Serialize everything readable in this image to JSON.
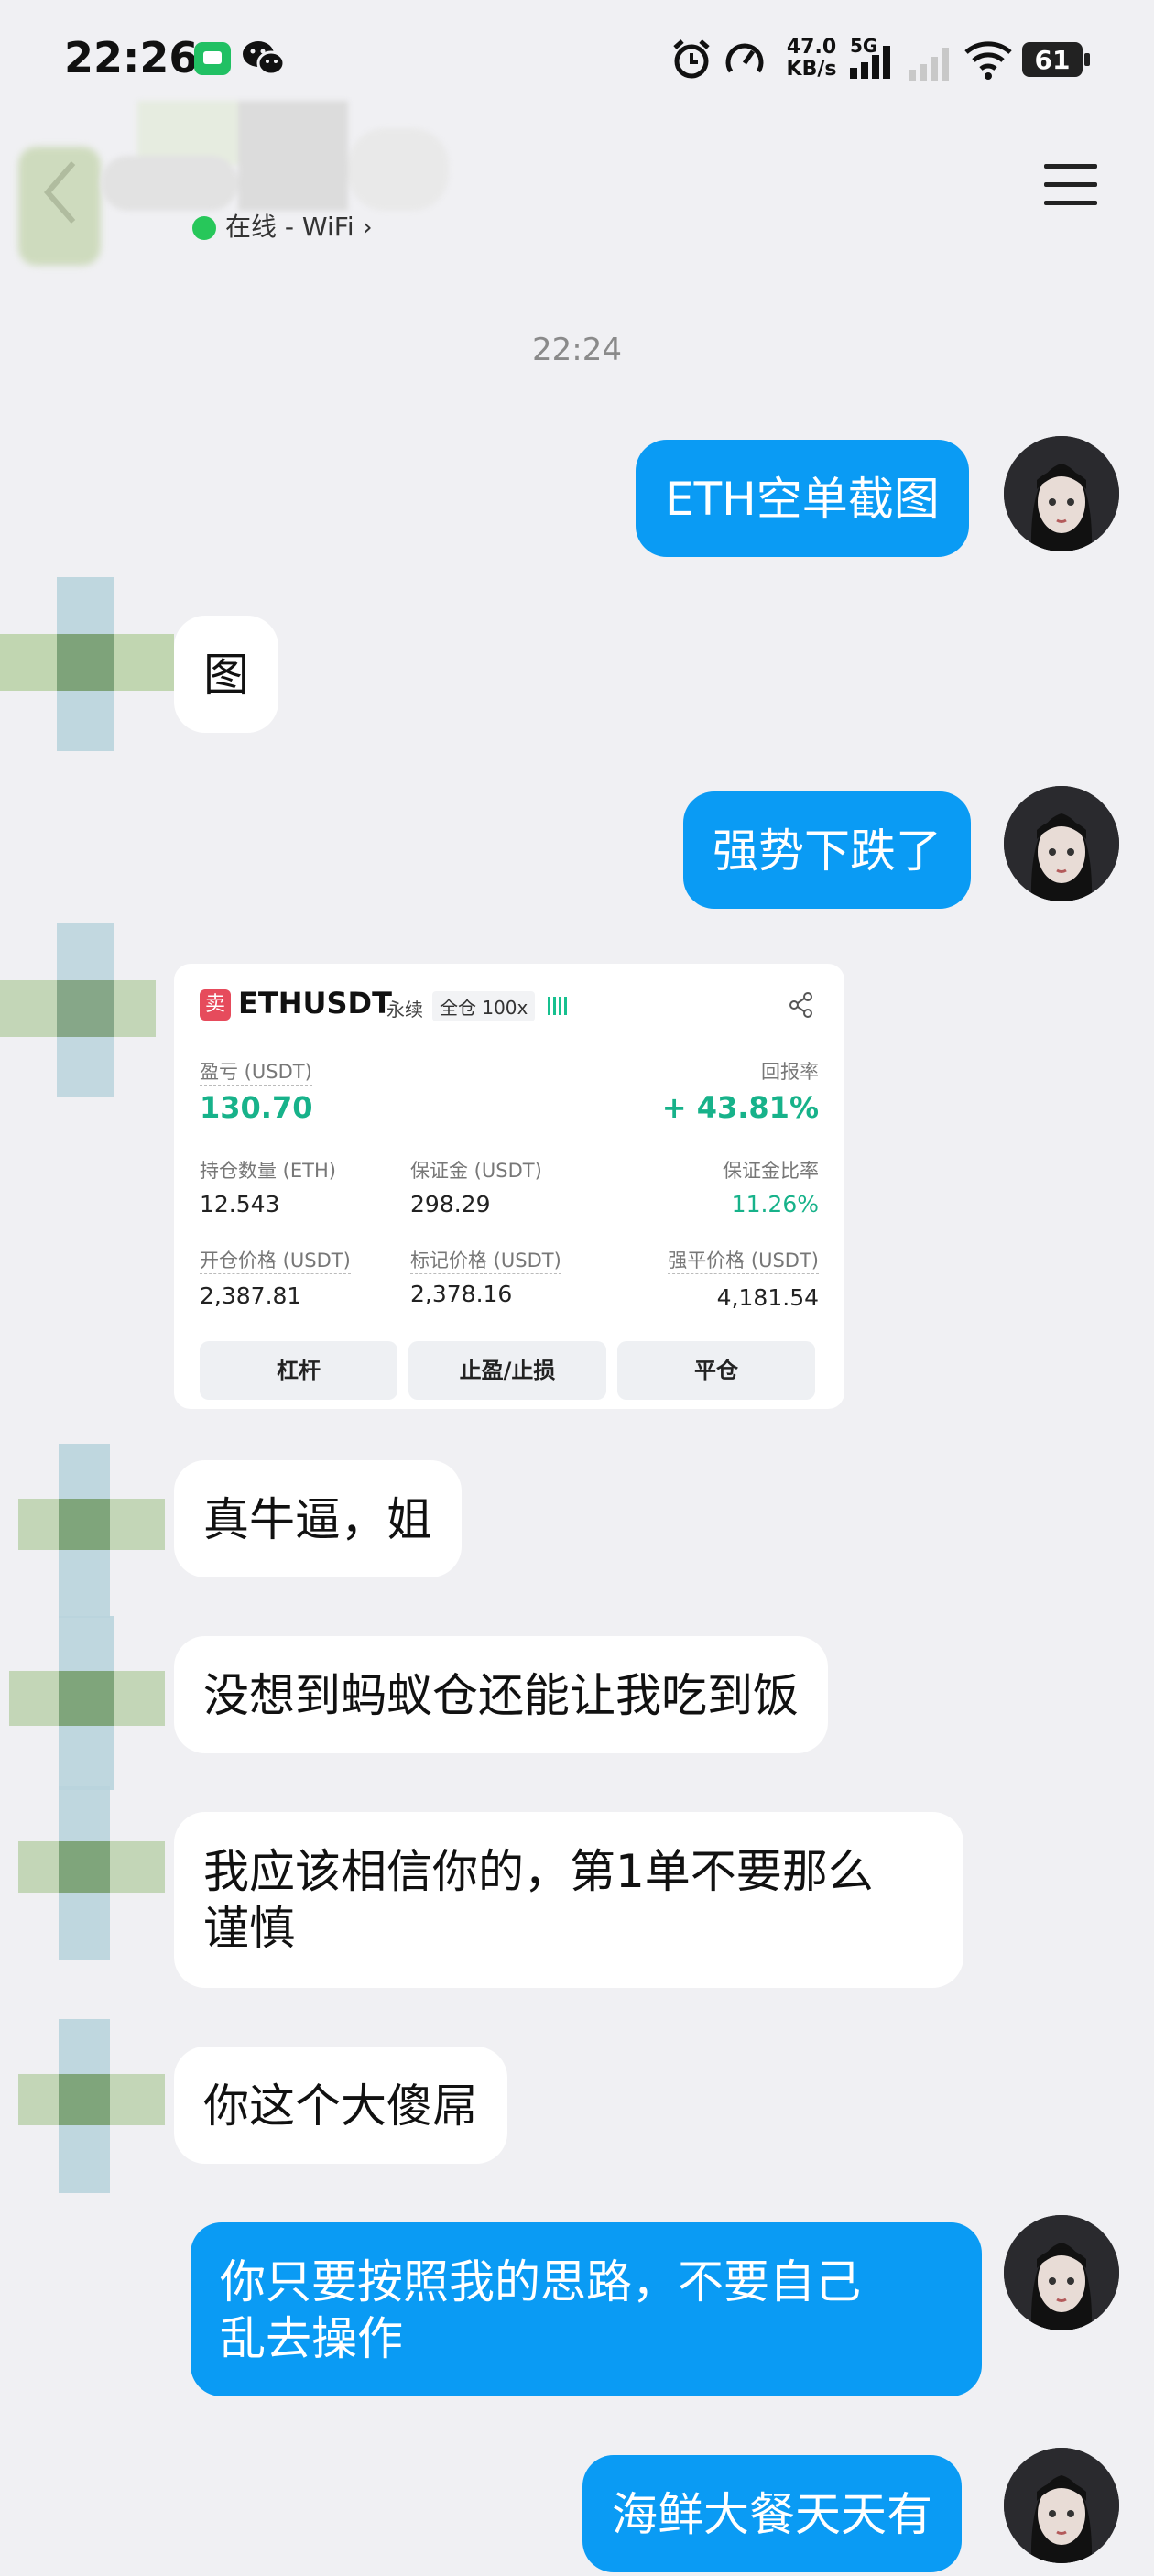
{
  "status_bar": {
    "time": "22:26",
    "net_speed_value": "47.0",
    "net_speed_unit": "KB/s",
    "signal_label": "5G",
    "battery": "61"
  },
  "header": {
    "contact_status": "在线 - WiFi"
  },
  "chat": {
    "timestamp": "22:24",
    "messages": [
      {
        "dir": "out",
        "text": "ETH空单截图"
      },
      {
        "dir": "in",
        "text": "图"
      },
      {
        "dir": "out",
        "text": "强势下跌了"
      },
      {
        "dir": "in",
        "text": "真牛逼，姐"
      },
      {
        "dir": "in",
        "text": "没想到蚂蚁仓还能让我吃到饭"
      },
      {
        "dir": "in",
        "text_line1": "我应该相信你的，第1单不要那么",
        "text_line2": "谨慎"
      },
      {
        "dir": "in",
        "text": "你这个大傻屌"
      },
      {
        "dir": "out",
        "text_line1": "你只要按照我的思路，不要自己",
        "text_line2": "乱去操作"
      },
      {
        "dir": "out",
        "text": "海鲜大餐天天有"
      }
    ]
  },
  "trade_card": {
    "badge": "卖",
    "symbol": "ETHUSDT",
    "type": "永续",
    "margin_mode": "全仓 100x",
    "pnl_label": "盈亏 (USDT)",
    "pnl_value": "130.70",
    "roe_label": "回报率",
    "roe_value": "+ 43.81%",
    "size_label": "持仓数量 (ETH)",
    "size_value": "12.543",
    "margin_label": "保证金 (USDT)",
    "margin_value": "298.29",
    "margin_ratio_label": "保证金比率",
    "margin_ratio_value": "11.26%",
    "entry_label": "开仓价格 (USDT)",
    "entry_value": "2,387.81",
    "mark_label": "标记价格 (USDT)",
    "mark_value": "2,378.16",
    "liq_label": "强平价格 (USDT)",
    "liq_value": "4,181.54",
    "btn_leverage": "杠杆",
    "btn_tpsl": "止盈/止损",
    "btn_close": "平仓",
    "colors": {
      "profit": "#17b28a",
      "badge": "#e64b5c"
    }
  }
}
